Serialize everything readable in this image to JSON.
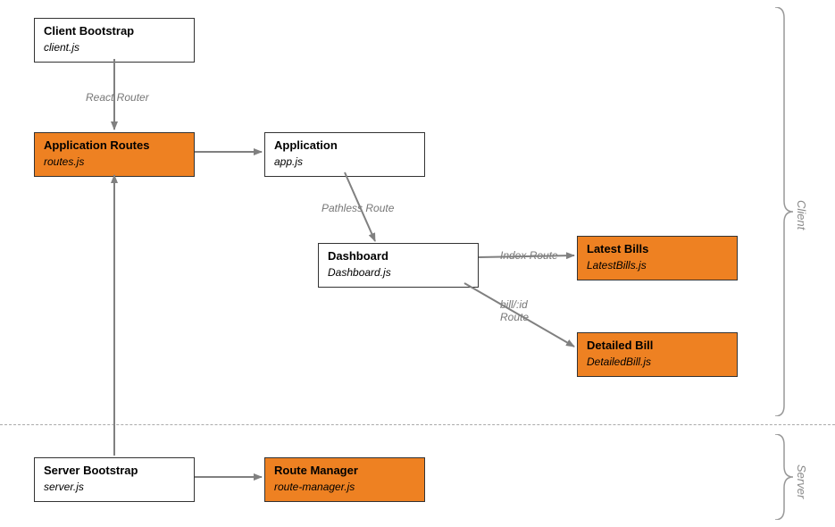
{
  "nodes": {
    "clientBootstrap": {
      "title": "Client Bootstrap",
      "file": "client.js"
    },
    "appRoutes": {
      "title": "Application Routes",
      "file": "routes.js"
    },
    "application": {
      "title": "Application",
      "file": "app.js"
    },
    "dashboard": {
      "title": "Dashboard",
      "file": "Dashboard.js"
    },
    "latestBills": {
      "title": "Latest Bills",
      "file": "LatestBills.js"
    },
    "detailedBill": {
      "title": "Detailed Bill",
      "file": "DetailedBill.js"
    },
    "serverBootstrap": {
      "title": "Server Bootstrap",
      "file": "server.js"
    },
    "routeManager": {
      "title": "Route Manager",
      "file": "route-manager.js"
    }
  },
  "edgeLabels": {
    "reactRouter": "React Router",
    "pathlessRoute": "Pathless Route",
    "indexRoute": "Index Route",
    "billIdRoute": "bill/:id\nRoute"
  },
  "sections": {
    "client": "Client",
    "server": "Server"
  },
  "colors": {
    "orange": "#ee8122",
    "arrow": "#808080"
  }
}
